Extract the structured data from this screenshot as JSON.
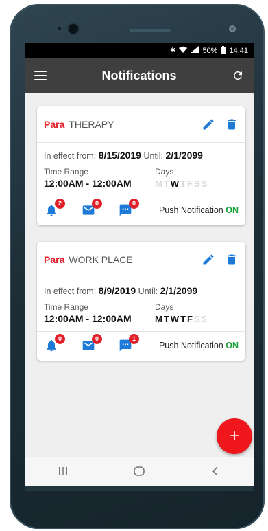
{
  "status_bar": {
    "battery": "50%",
    "time": "14:41"
  },
  "app_bar": {
    "title": "Notifications"
  },
  "cards": [
    {
      "who": "Para",
      "category": "THERAPY",
      "effect_label": "In effect from:",
      "from": "8/15/2019",
      "until_label": "Until:",
      "until": "2/1/2099",
      "time_range_label": "Time Range",
      "time_range": "12:00AM - 12:00AM",
      "days_label": "Days",
      "days": [
        {
          "d": "M",
          "on": false
        },
        {
          "d": "T",
          "on": false
        },
        {
          "d": "W",
          "on": true
        },
        {
          "d": "T",
          "on": false
        },
        {
          "d": "F",
          "on": false
        },
        {
          "d": "S",
          "on": false
        },
        {
          "d": "S",
          "on": false
        }
      ],
      "badges": {
        "bell": "2",
        "mail": "0",
        "chat": "0"
      },
      "push_label": "Push Notification",
      "push_state": "ON"
    },
    {
      "who": "Para",
      "category": "WORK PLACE",
      "effect_label": "In effect from:",
      "from": "8/9/2019",
      "until_label": "Until:",
      "until": "2/1/2099",
      "time_range_label": "Time Range",
      "time_range": "12:00AM - 12:00AM",
      "days_label": "Days",
      "days": [
        {
          "d": "M",
          "on": true
        },
        {
          "d": "T",
          "on": true
        },
        {
          "d": "W",
          "on": true
        },
        {
          "d": "T",
          "on": true
        },
        {
          "d": "F",
          "on": true
        },
        {
          "d": "S",
          "on": false
        },
        {
          "d": "S",
          "on": false
        }
      ],
      "badges": {
        "bell": "0",
        "mail": "0",
        "chat": "1"
      },
      "push_label": "Push Notification",
      "push_state": "ON"
    }
  ],
  "fab": {
    "label": "+"
  },
  "colors": {
    "accent": "#1e7ad6",
    "red": "#e1202a",
    "green": "#1aa33a",
    "appbar": "#3f3f3f"
  },
  "icons": [
    "menu-icon",
    "refresh-icon",
    "edit-icon",
    "delete-icon",
    "bell-icon",
    "mail-icon",
    "chat-icon",
    "recents-icon",
    "home-icon",
    "back-icon"
  ]
}
